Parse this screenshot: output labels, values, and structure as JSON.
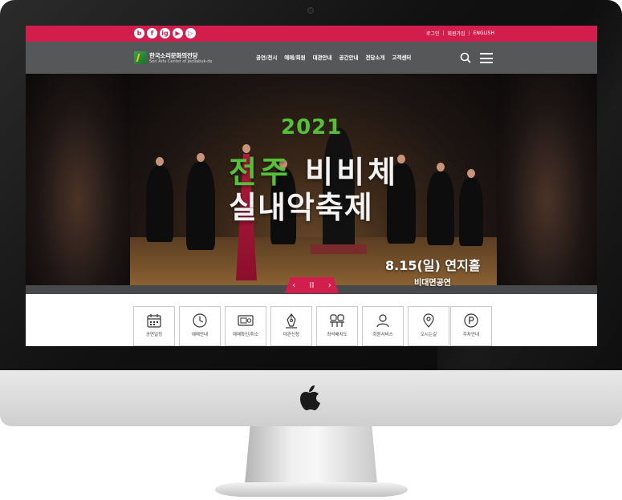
{
  "social": [
    "b",
    "f",
    "ig",
    "▶",
    "▷"
  ],
  "util_links": {
    "login": "로그인",
    "join": "회원가입",
    "lang": "ENGLISH"
  },
  "logo": {
    "ko": "한국소리문화의전당",
    "en": "Sori Arts Center of Jeollabuk-do"
  },
  "menu": [
    "공연/전시",
    "예매/회원",
    "대관안내",
    "공간안내",
    "전당소개",
    "고객센터"
  ],
  "hero": {
    "year": "2021",
    "title_accent": "전주",
    "title_rest": " 비비체",
    "title_line2": "실내악축제",
    "date": "8.15(일) 연지홀",
    "note": "비대면공연"
  },
  "slider": {
    "prev": "‹",
    "pause": "II",
    "next": "›"
  },
  "quick_menu": [
    {
      "label": "공연일정",
      "icon": "calendar-icon"
    },
    {
      "label": "예매안내",
      "icon": "clock-icon"
    },
    {
      "label": "예매확인/취소",
      "icon": "ticket-icon"
    },
    {
      "label": "대관신청",
      "icon": "pen-icon"
    },
    {
      "label": "좌석배치도",
      "icon": "seat-icon"
    },
    {
      "label": "회원서비스",
      "icon": "user-icon"
    },
    {
      "label": "오시는길",
      "icon": "location-icon"
    },
    {
      "label": "주차안내",
      "icon": "parking-icon"
    }
  ],
  "colors": {
    "brand": "#d21e4d",
    "nav": "#565759",
    "accent_green": "#57c03a"
  }
}
